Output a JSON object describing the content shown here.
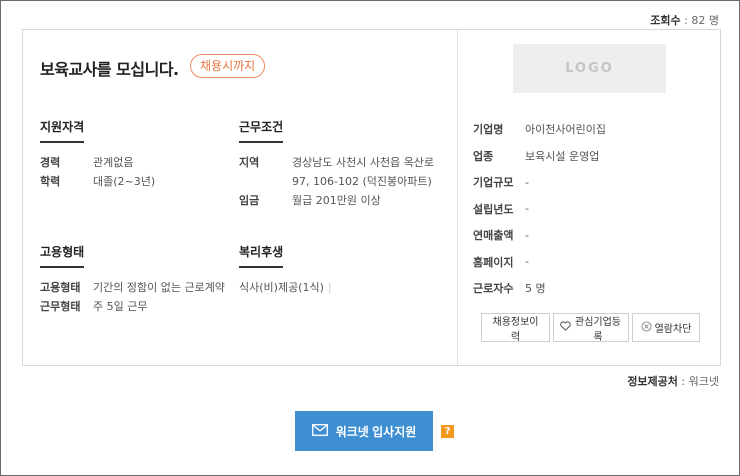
{
  "views": {
    "label": "조회수",
    "value": "82 명"
  },
  "job": {
    "title": "보육교사를 모십니다.",
    "deadline": "채용시까지"
  },
  "qualifications": {
    "title": "지원자격",
    "rows": [
      {
        "k": "경력",
        "v": "관계없음"
      },
      {
        "k": "학력",
        "v": "대졸(2~3년)"
      }
    ]
  },
  "conditions": {
    "title": "근무조건",
    "location_label": "지역",
    "location_line1": "경상남도 사천시 사천읍 옥산로",
    "location_line2": "97, 106-102 (덕진봉아파트)",
    "wage_label": "임금",
    "wage_value": "월급 201만원 이상"
  },
  "employment": {
    "title": "고용형태",
    "rows": [
      {
        "k": "고용형태",
        "v": "기간의 정함이 없는 근로계약"
      },
      {
        "k": "근무형태",
        "v": "주 5일 근무"
      }
    ]
  },
  "benefits": {
    "title": "복리후생",
    "value": "식사(비)제공(1식)",
    "sep": "|"
  },
  "company": {
    "logo_text": "LOGO",
    "rows": [
      {
        "k": "기업명",
        "v": "아이천사어린이집"
      },
      {
        "k": "업종",
        "v": "보육시설 운영업"
      },
      {
        "k": "기업규모",
        "v": "-"
      },
      {
        "k": "설립년도",
        "v": "-"
      },
      {
        "k": "연매출액",
        "v": "-"
      },
      {
        "k": "홈페이지",
        "v": "-"
      },
      {
        "k": "근로자수",
        "v": "5 명"
      }
    ],
    "buttons": {
      "history": "채용정보이력",
      "favorite": "관심기업등록",
      "block": "열람차단"
    }
  },
  "provider": {
    "label": "정보제공처",
    "value": "워크넷"
  },
  "apply": {
    "label": "워크넷 입사지원",
    "help": "?"
  },
  "colors": {
    "accent": "#3d8fd1",
    "badge": "#e8733f",
    "help": "#f29a1f"
  }
}
